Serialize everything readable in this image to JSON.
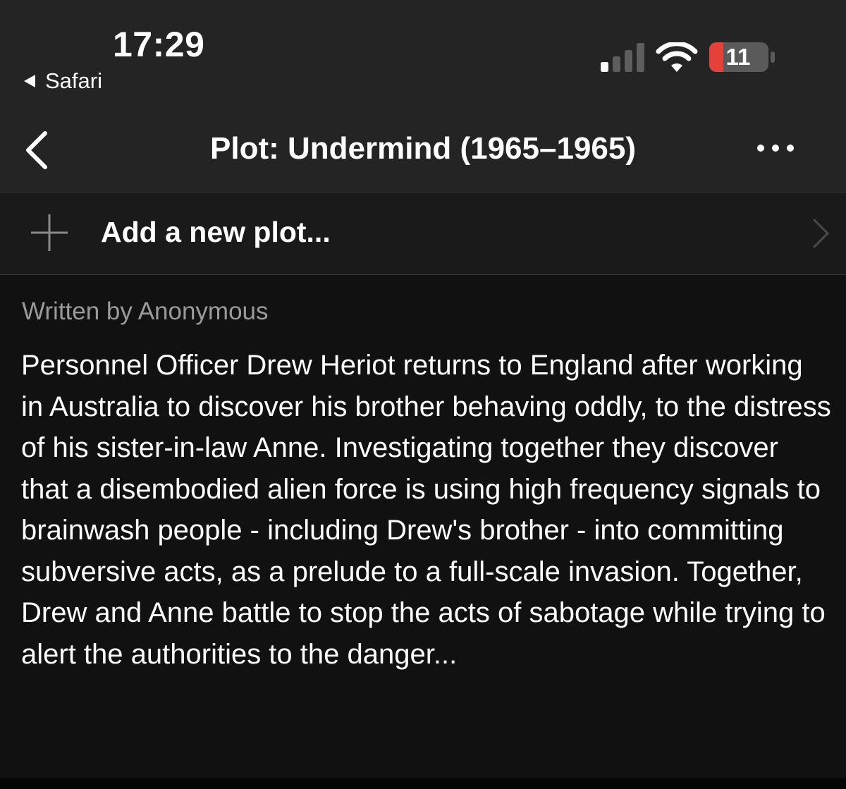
{
  "status_bar": {
    "time": "17:29",
    "back_app": "Safari",
    "battery_level": "11",
    "battery_color": "#e5403a",
    "signal_bars_active": 1,
    "signal_bars_total": 4
  },
  "nav": {
    "title": "Plot: Undermind (1965–1965)",
    "back_icon": "chevron-left-icon",
    "more_icon": "ellipsis-icon"
  },
  "add_row": {
    "label": "Add a new plot...",
    "icon": "plus-icon"
  },
  "plot": {
    "author": "Written by Anonymous",
    "text": "Personnel Officer Drew Heriot returns to England after working in Australia to discover his brother behaving oddly, to the distress of his sister-in-law Anne. Investigating together they discover that a disembodied alien force is using high frequency signals to brainwash people - including Drew's brother - into committing subversive acts, as a prelude to a full-scale invasion. Together, Drew and Anne battle to stop the acts of sabotage while trying to alert the authorities to the danger..."
  }
}
